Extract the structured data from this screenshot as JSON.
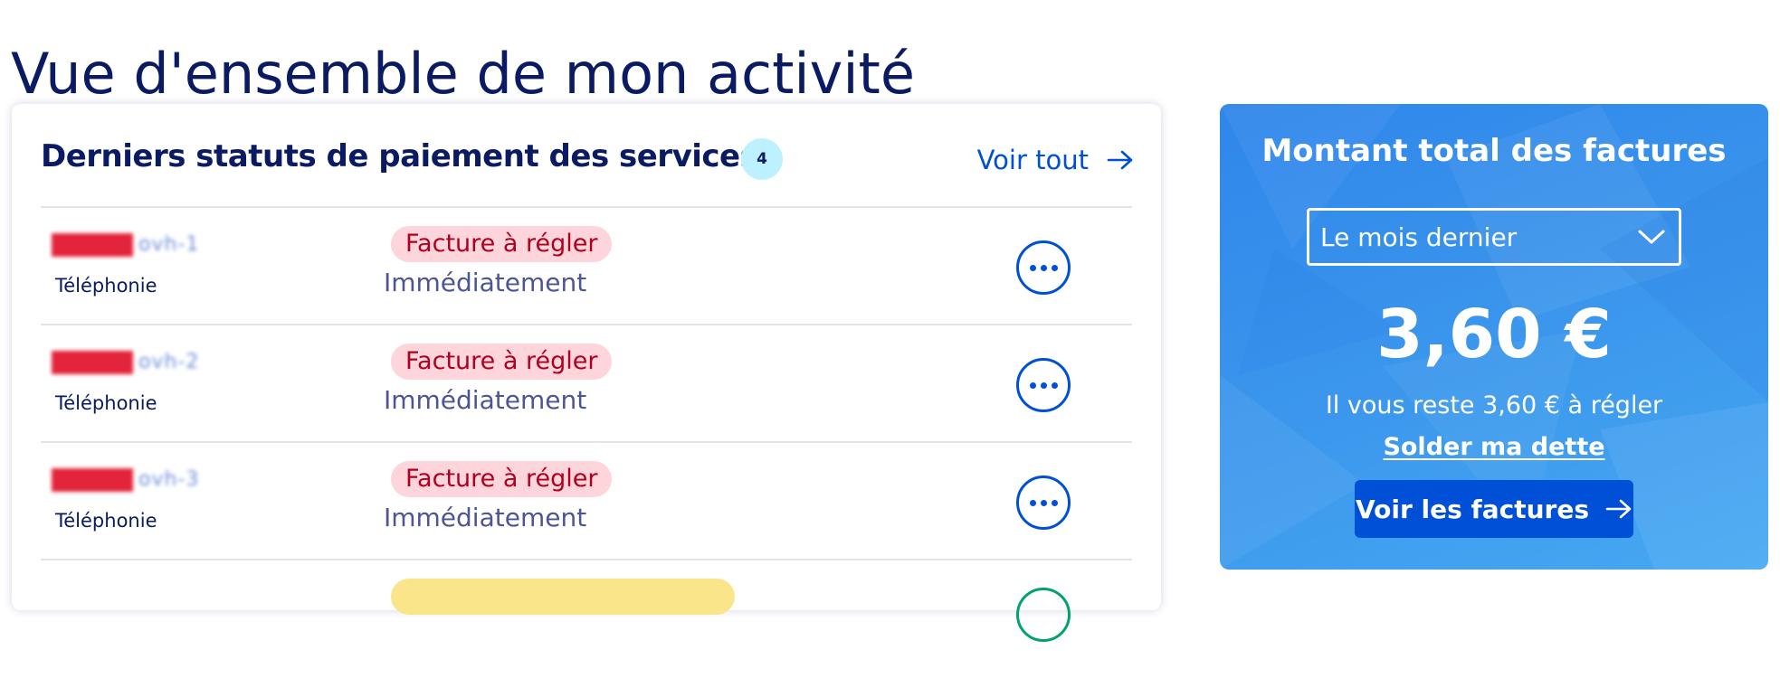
{
  "page": {
    "title": "Vue d'ensemble de mon activité"
  },
  "status_card": {
    "title": "Derniers statuts de paiement des services",
    "count": "4",
    "see_all": "Voir tout",
    "rows": [
      {
        "service": "ovh-1",
        "type": "Téléphonie",
        "status": "Facture à régler",
        "due": "Immédiatement"
      },
      {
        "service": "ovh-2",
        "type": "Téléphonie",
        "status": "Facture à régler",
        "due": "Immédiatement"
      },
      {
        "service": "ovh-3",
        "type": "Téléphonie",
        "status": "Facture à régler",
        "due": "Immédiatement"
      }
    ]
  },
  "total_card": {
    "title": "Montant total des factures",
    "period": "Le mois dernier",
    "amount": "3,60 €",
    "remaining": "Il vous reste 3,60 € à régler",
    "settle_link": "Solder ma dette",
    "invoices_button": "Voir les factures"
  },
  "icons": {
    "see_all": "arrow-right-icon",
    "select": "chevron-down-icon",
    "row_action": "more-horizontal-icon",
    "invoices": "arrow-right-icon"
  },
  "colors": {
    "primary": "#0050d7",
    "heading": "#0a1b63",
    "error_bg": "#ffd5dc",
    "error_text": "#b00020",
    "badge_bg": "#bef1ff",
    "card_blue": "#3b96ec"
  }
}
